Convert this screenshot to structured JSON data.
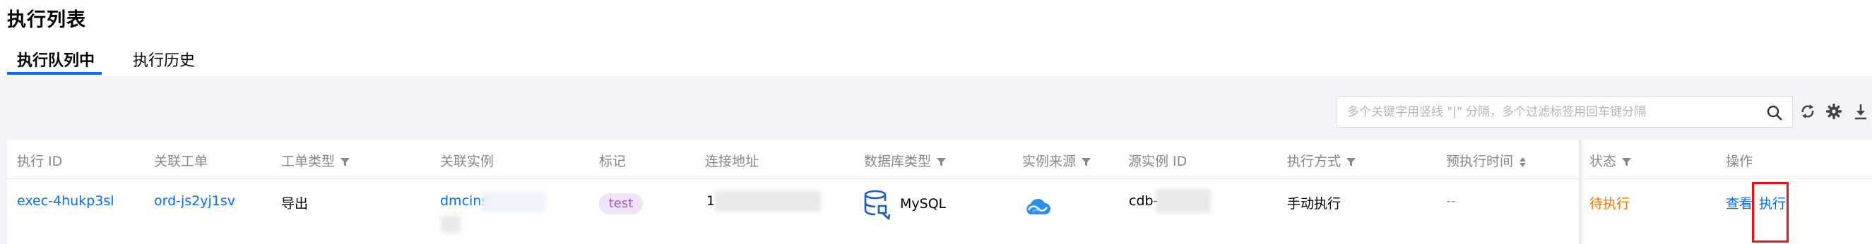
{
  "page": {
    "title": "执行列表"
  },
  "tabs": [
    {
      "label": "执行队列中",
      "active": true
    },
    {
      "label": "执行历史",
      "active": false
    }
  ],
  "search": {
    "placeholder": "多个关键字用竖线 \"|\" 分隔，多个过滤标签用回车键分隔",
    "value": ""
  },
  "toolbar": {
    "icons": [
      "search-icon",
      "refresh-icon",
      "settings-icon",
      "download-icon"
    ]
  },
  "table": {
    "columns": [
      {
        "label": "执行 ID",
        "filter": false
      },
      {
        "label": "关联工单",
        "filter": false
      },
      {
        "label": "工单类型",
        "filter": true
      },
      {
        "label": "关联实例",
        "filter": false
      },
      {
        "label": "标记",
        "filter": false
      },
      {
        "label": "连接地址",
        "filter": false
      },
      {
        "label": "数据库类型",
        "filter": true
      },
      {
        "label": "实例来源",
        "filter": true
      },
      {
        "label": "源实例 ID",
        "filter": false
      },
      {
        "label": "执行方式",
        "filter": true
      },
      {
        "label": "预执行时间",
        "sort": true
      },
      {
        "label": "状态",
        "filter": true
      },
      {
        "label": "操作",
        "filter": false
      }
    ],
    "rows": [
      {
        "exec_id": "exec-4hukp3sl",
        "ticket": "ord-js2yj1sv",
        "ticket_type": "导出",
        "instance": "dmcins",
        "tag": "test",
        "address": "1",
        "db_type": "MySQL",
        "db_icon": "database-icon",
        "source_icon": "cloud-icon",
        "source_instance": "cdb-",
        "exec_mode": "手动执行",
        "pre_exec_time": "--",
        "status": "待执行",
        "actions": {
          "view": "查看",
          "execute": "执行"
        }
      }
    ]
  },
  "colors": {
    "accent": "#006eff",
    "status_pending": "#ff7800",
    "tag_bg": "#f1e4fa",
    "tag_fg": "#a15ad6",
    "highlight_box": "#ee1111"
  }
}
